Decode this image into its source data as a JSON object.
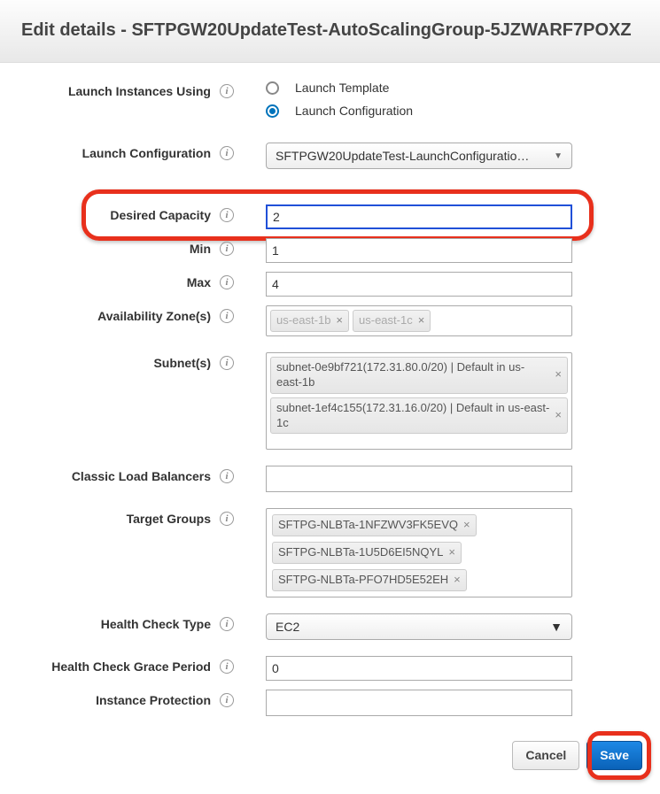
{
  "header": {
    "title": "Edit details - SFTPGW20UpdateTest-AutoScalingGroup-5JZWARF7POXZ"
  },
  "launchInstances": {
    "label": "Launch Instances Using",
    "options": {
      "template": "Launch Template",
      "config": "Launch Configuration"
    },
    "selected": "config"
  },
  "launchConfig": {
    "label": "Launch Configuration",
    "value": "SFTPGW20UpdateTest-LaunchConfiguratio…"
  },
  "desired": {
    "label": "Desired Capacity",
    "value": "2"
  },
  "min": {
    "label": "Min",
    "value": "1"
  },
  "max": {
    "label": "Max",
    "value": "4"
  },
  "az": {
    "label": "Availability Zone(s)",
    "tags": [
      "us-east-1b",
      "us-east-1c"
    ]
  },
  "subnets": {
    "label": "Subnet(s)",
    "tags": [
      "subnet-0e9bf721(172.31.80.0/20) | Default in us-east-1b",
      "subnet-1ef4c155(172.31.16.0/20) | Default in us-east-1c"
    ]
  },
  "clb": {
    "label": "Classic Load Balancers"
  },
  "targetGroups": {
    "label": "Target Groups",
    "tags": [
      "SFTPG-NLBTa-1NFZWV3FK5EVQ",
      "SFTPG-NLBTa-1U5D6EI5NQYL",
      "SFTPG-NLBTa-PFO7HD5E52EH"
    ]
  },
  "healthType": {
    "label": "Health Check Type",
    "value": "EC2"
  },
  "healthGrace": {
    "label": "Health Check Grace Period",
    "value": "0"
  },
  "instanceProt": {
    "label": "Instance Protection"
  },
  "buttons": {
    "cancel": "Cancel",
    "save": "Save"
  }
}
